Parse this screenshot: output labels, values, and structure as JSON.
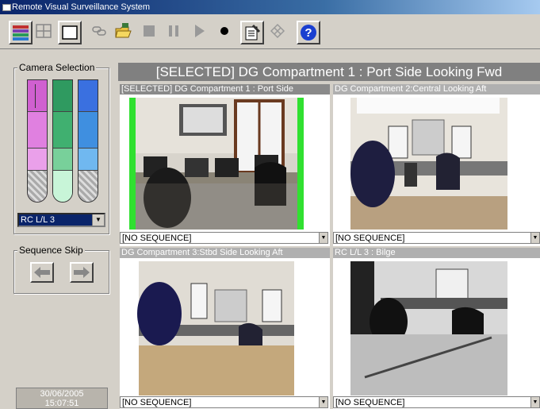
{
  "window": {
    "title": "Remote Visual Surveillance System"
  },
  "toolbar": {
    "buttons": [
      {
        "name": "camera-list-icon"
      },
      {
        "name": "grid-layout-icon"
      },
      {
        "name": "single-view-icon"
      },
      {
        "name": "link-icon"
      },
      {
        "name": "open-folder-icon"
      },
      {
        "name": "stop-icon"
      },
      {
        "name": "pause-icon"
      },
      {
        "name": "play-icon"
      },
      {
        "name": "record-icon"
      },
      {
        "name": "properties-icon"
      },
      {
        "name": "network-icon"
      },
      {
        "name": "help-icon"
      }
    ]
  },
  "left": {
    "camera_selection_label": "Camera Selection",
    "camera_dropdown_value": "RC L/L 3",
    "sequence_skip_label": "Sequence Skip",
    "datetime": {
      "date": "30/06/2005",
      "time": "15:07:51"
    },
    "colors": {
      "magenta": "#e080e0",
      "green": "#40b070",
      "blue": "#3f8fe0"
    }
  },
  "main": {
    "header": "[SELECTED] DG Compartment 1 : Port Side Looking Fwd",
    "cells": [
      {
        "title": "[SELECTED] DG Compartment 1 : Port Side",
        "sequence": "[NO SEQUENCE]"
      },
      {
        "title": "DG Compartment 2:Central Looking Aft",
        "sequence": "[NO SEQUENCE]"
      },
      {
        "title": "DG Compartment 3:Stbd Side Looking Aft",
        "sequence": "[NO SEQUENCE]"
      },
      {
        "title": "RC L/L 3 : Bilge",
        "sequence": "[NO SEQUENCE]"
      }
    ]
  }
}
